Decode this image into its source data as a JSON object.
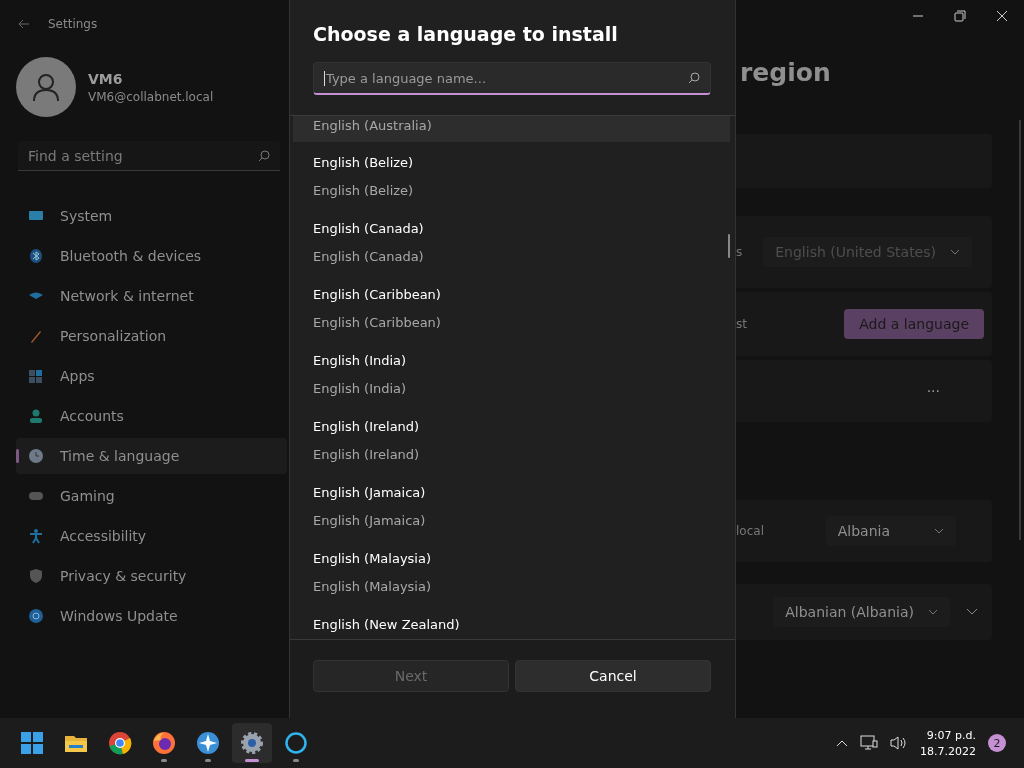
{
  "window": {
    "title": "Settings"
  },
  "user": {
    "name": "VM6",
    "email": "VM6@collabnet.local"
  },
  "search": {
    "placeholder": "Find a setting"
  },
  "sidebar": {
    "items": [
      {
        "label": "System",
        "selected": false
      },
      {
        "label": "Bluetooth & devices",
        "selected": false
      },
      {
        "label": "Network & internet",
        "selected": false
      },
      {
        "label": "Personalization",
        "selected": false
      },
      {
        "label": "Apps",
        "selected": false
      },
      {
        "label": "Accounts",
        "selected": false
      },
      {
        "label": "Time & language",
        "selected": true
      },
      {
        "label": "Gaming",
        "selected": false
      },
      {
        "label": "Accessibility",
        "selected": false
      },
      {
        "label": "Privacy & security",
        "selected": false
      },
      {
        "label": "Windows Update",
        "selected": false
      }
    ]
  },
  "content": {
    "title": "region",
    "display_language": {
      "label": "s",
      "value": "English (United States)"
    },
    "preferred": {
      "label": "st",
      "button": "Add a language"
    },
    "more_button": "···",
    "country": {
      "label": "local",
      "value": "Albania"
    },
    "format": {
      "value": "Albanian (Albania)"
    }
  },
  "dialog": {
    "title": "Choose a language to install",
    "search": {
      "placeholder": "Type a language name..."
    },
    "languages": [
      {
        "native": "English (Australia)",
        "hovered": true
      },
      {
        "name": "English (Belize)",
        "native": "English (Belize)",
        "hovered": false
      },
      {
        "name": "English (Canada)",
        "native": "English (Canada)",
        "hovered": false
      },
      {
        "name": "English (Caribbean)",
        "native": "English (Caribbean)",
        "hovered": false
      },
      {
        "name": "English (India)",
        "native": "English (India)",
        "hovered": false
      },
      {
        "name": "English (Ireland)",
        "native": "English (Ireland)",
        "hovered": false
      },
      {
        "name": "English (Jamaica)",
        "native": "English (Jamaica)",
        "hovered": false
      },
      {
        "name": "English (Malaysia)",
        "native": "English (Malaysia)",
        "hovered": false
      },
      {
        "name": "English (New Zealand)",
        "hovered": false
      }
    ],
    "buttons": [
      {
        "label": "Next",
        "disabled": true
      },
      {
        "label": "Cancel",
        "disabled": false
      }
    ]
  },
  "taskbar": {
    "apps": [
      {
        "kind": "start",
        "running": false,
        "active": false
      },
      {
        "kind": "folder",
        "running": false,
        "active": false
      },
      {
        "kind": "chrome",
        "running": false,
        "active": false
      },
      {
        "kind": "firefox",
        "running": true,
        "active": false
      },
      {
        "kind": "star",
        "running": true,
        "active": false
      },
      {
        "kind": "gear",
        "running": true,
        "active": true
      },
      {
        "kind": "ring",
        "running": true,
        "active": false
      }
    ],
    "time": "9:07 p.d.",
    "date": "18.7.2022",
    "notifications": "2"
  }
}
